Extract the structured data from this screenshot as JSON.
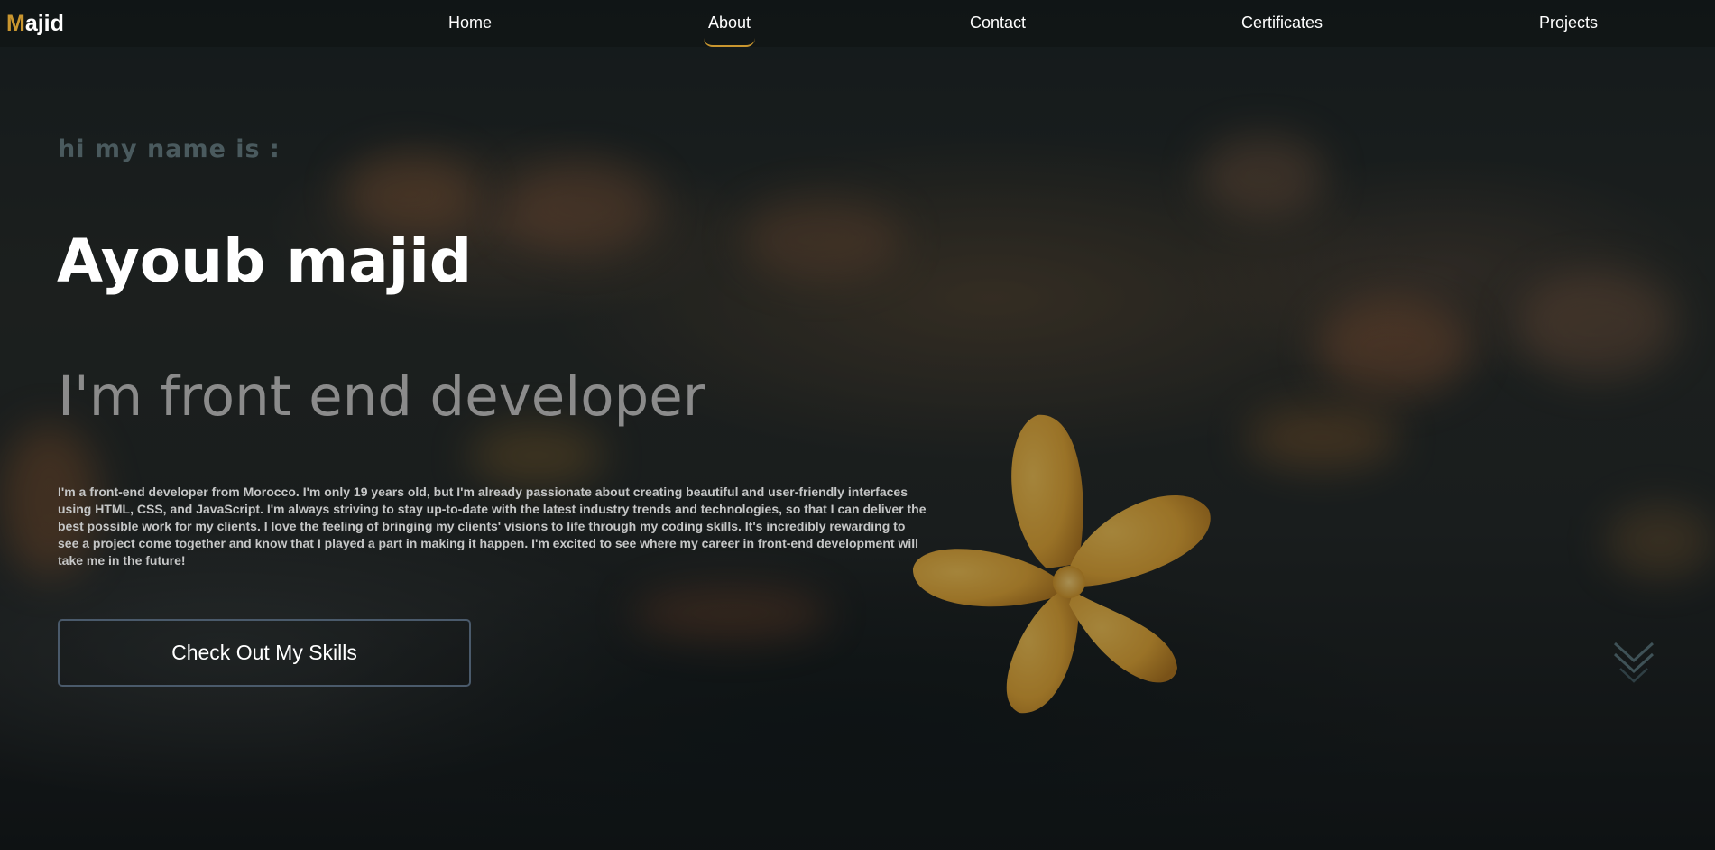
{
  "brand": {
    "logo_accent": "M",
    "logo_rest": "ajid",
    "accent_color": "#c9962f"
  },
  "nav": {
    "items": [
      {
        "label": "Home",
        "active": false
      },
      {
        "label": "About",
        "active": true
      },
      {
        "label": "Contact",
        "active": false
      },
      {
        "label": "Certificates",
        "active": false
      },
      {
        "label": "Projects",
        "active": false
      }
    ]
  },
  "hero": {
    "greeting": "hi my name is :",
    "name": "Ayoub majid",
    "role": "I'm front end developer",
    "bio": "I'm a front-end developer from Morocco. I'm only 19 years old, but I'm already passionate about creating beautiful and user-friendly interfaces using HTML, CSS, and JavaScript. I'm always striving to stay up-to-date with the latest industry trends and technologies, so that I can deliver the best possible work for my clients. I love the feeling of bringing my clients' visions to life through my coding skills. It's incredibly rewarding to see a project come together and know that I played a part in making it happen. I'm excited to see where my career in front-end development will take me in the future!",
    "cta_label": "Check Out My Skills"
  },
  "icons": {
    "scroll_down": "double-chevron-down-icon"
  }
}
